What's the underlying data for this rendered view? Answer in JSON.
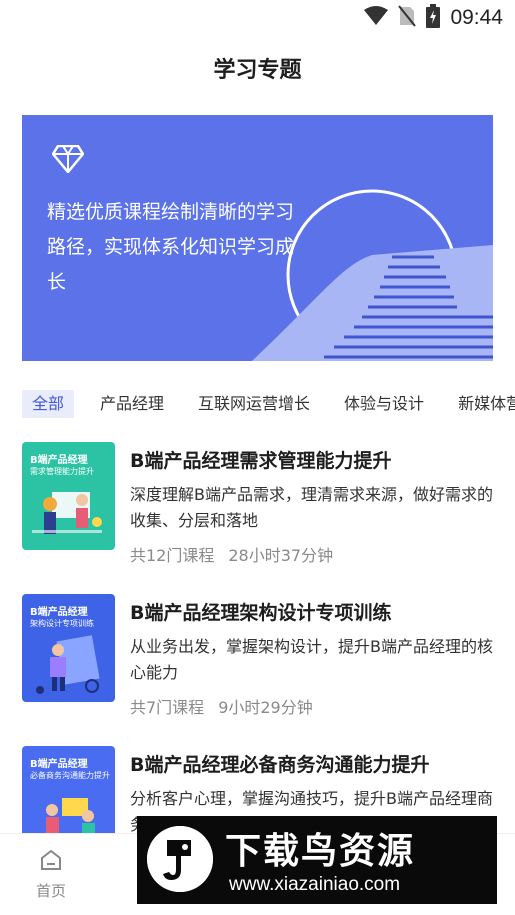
{
  "status": {
    "time": "09:44"
  },
  "header": {
    "title": "学习专题"
  },
  "banner": {
    "text": "精选优质课程绘制清晰的学习路径，实现体系化知识学习成长"
  },
  "tabs": [
    "全部",
    "产品经理",
    "互联网运营增长",
    "体验与设计",
    "新媒体营"
  ],
  "courses": [
    {
      "cover_title": "B端产品经理",
      "cover_subtitle": "需求管理能力提升",
      "title": "B端产品经理需求管理能力提升",
      "desc": "深度理解B端产品需求，理清需求来源，做好需求的收集、分层和落地",
      "count": "共12门课程",
      "duration": "28小时37分钟"
    },
    {
      "cover_title": "B端产品经理",
      "cover_subtitle": "架构设计专项训练",
      "title": "B端产品经理架构设计专项训练",
      "desc": "从业务出发，掌握架构设计，提升B端产品经理的核心能力",
      "count": "共7门课程",
      "duration": "9小时29分钟"
    },
    {
      "cover_title": "B端产品经理",
      "cover_subtitle": "必备商务沟通能力提升",
      "title": "B端产品经理必备商务沟通能力提升",
      "desc": "分析客户心理，掌握沟通技巧，提升B端产品经理商务沟通能力"
    }
  ],
  "nav": {
    "home": "首页"
  },
  "watermark": {
    "big": "下载鸟资源",
    "small": "www.xiazainiao.com"
  },
  "colors": {
    "accent": "#4458dc",
    "banner": "#5b72e8"
  }
}
